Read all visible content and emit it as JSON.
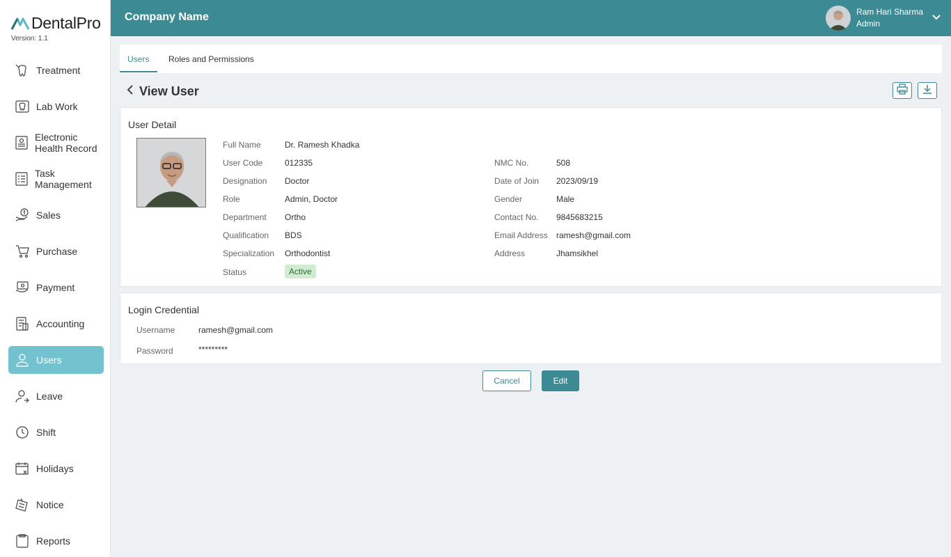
{
  "app": {
    "logo_text": "DentalPro",
    "version": "Version: 1.1"
  },
  "sidebar": {
    "items": [
      {
        "label": "Treatment",
        "icon": "tooth-treatment-icon"
      },
      {
        "label": "Lab Work",
        "icon": "lab-tooth-icon"
      },
      {
        "label": "Electronic Health Record",
        "icon": "health-record-icon"
      },
      {
        "label": "Task Management",
        "icon": "task-list-icon"
      },
      {
        "label": "Sales",
        "icon": "sales-icon"
      },
      {
        "label": "Purchase",
        "icon": "cart-icon"
      },
      {
        "label": "Payment",
        "icon": "payment-icon"
      },
      {
        "label": "Accounting",
        "icon": "accounting-icon"
      },
      {
        "label": "Users",
        "icon": "user-icon",
        "active": true
      },
      {
        "label": "Leave",
        "icon": "leave-icon"
      },
      {
        "label": "Shift",
        "icon": "clock-icon"
      },
      {
        "label": "Holidays",
        "icon": "calendar-icon"
      },
      {
        "label": "Notice",
        "icon": "notice-icon"
      },
      {
        "label": "Reports",
        "icon": "reports-icon"
      }
    ]
  },
  "header": {
    "company": "Company Name",
    "user_name": "Ram Hari Sharma",
    "user_role": "Admin"
  },
  "tabs": [
    {
      "label": "Users",
      "active": true
    },
    {
      "label": "Roles and Permissions",
      "active": false
    }
  ],
  "page": {
    "title": "View User"
  },
  "user_detail": {
    "title": "User Detail",
    "left": [
      {
        "label": "Full Name",
        "value": "Dr. Ramesh Khadka"
      },
      {
        "label": "User Code",
        "value": "012335"
      },
      {
        "label": "Designation",
        "value": "Doctor"
      },
      {
        "label": "Role",
        "value": "Admin, Doctor"
      },
      {
        "label": "Department",
        "value": "Ortho"
      },
      {
        "label": "Qualification",
        "value": "BDS"
      },
      {
        "label": "Specialization",
        "value": "Orthodontist"
      },
      {
        "label": "Status",
        "value": "Active"
      }
    ],
    "right": [
      {
        "label": "NMC No.",
        "value": "508"
      },
      {
        "label": "Date of Join",
        "value": "2023/09/19"
      },
      {
        "label": "Gender",
        "value": "Male"
      },
      {
        "label": "Contact No.",
        "value": "9845683215"
      },
      {
        "label": "Email Address",
        "value": "ramesh@gmail.com"
      },
      {
        "label": "Address",
        "value": "Jhamsikhel"
      }
    ]
  },
  "login": {
    "title": "Login Credential",
    "username_label": "Username",
    "username": "ramesh@gmail.com",
    "password_label": "Password",
    "password": "*********"
  },
  "actions": {
    "cancel": "Cancel",
    "edit": "Edit"
  },
  "colors": {
    "primary": "#3b8a94",
    "active_nav": "#73c2cf",
    "status_bg": "#d2ecd3"
  }
}
